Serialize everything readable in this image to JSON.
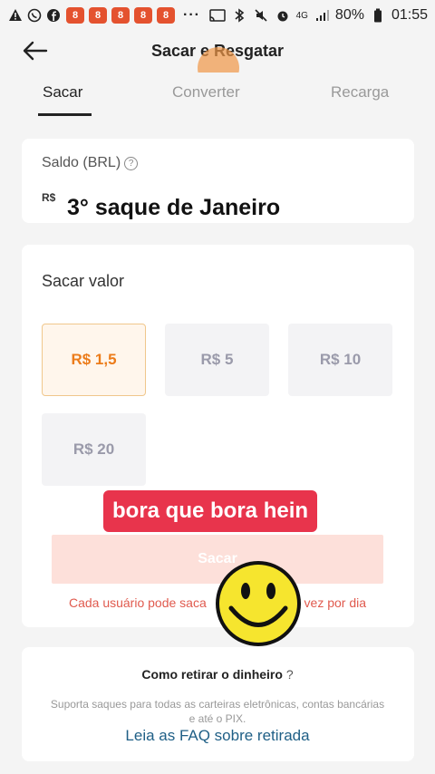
{
  "status_bar": {
    "battery": "80%",
    "time": "01:55",
    "network": "4G",
    "notification_icons": [
      "warning-icon",
      "whatsapp-icon",
      "facebook-icon",
      "app-icon",
      "app-icon",
      "app-icon",
      "app-icon",
      "app-icon"
    ],
    "app_icon_glyph": "8",
    "more": "···"
  },
  "header": {
    "title": "Sacar e Resgatar"
  },
  "tabs": [
    {
      "label": "Sacar",
      "active": true
    },
    {
      "label": "Converter",
      "active": false
    },
    {
      "label": "Recarga",
      "active": false
    }
  ],
  "balance": {
    "label": "Saldo (BRL)",
    "help": "?",
    "currency": "R$",
    "overlay_caption": "3° saque de Janeiro"
  },
  "withdraw": {
    "title": "Sacar valor",
    "amounts": [
      {
        "label": "R$ 1,5",
        "selected": true
      },
      {
        "label": "R$ 5",
        "selected": false
      },
      {
        "label": "R$ 10",
        "selected": false
      },
      {
        "label": "R$ 20",
        "selected": false
      }
    ],
    "banner": "bora que bora hein",
    "button": "Sacar",
    "note_left": "Cada usuário pode saca",
    "note_right": "vez por dia"
  },
  "how_to": {
    "title": "Como retirar o dinheiro",
    "help": "?",
    "description": "Suporta saques para todas as carteiras eletrônicas, contas bancárias e até o PIX.",
    "faq_link": "Leia as FAQ sobre retirada"
  },
  "colors": {
    "accent": "#ec7c1a",
    "banner": "#e8344c",
    "link": "#1f5f86",
    "note": "#e05a4e"
  }
}
